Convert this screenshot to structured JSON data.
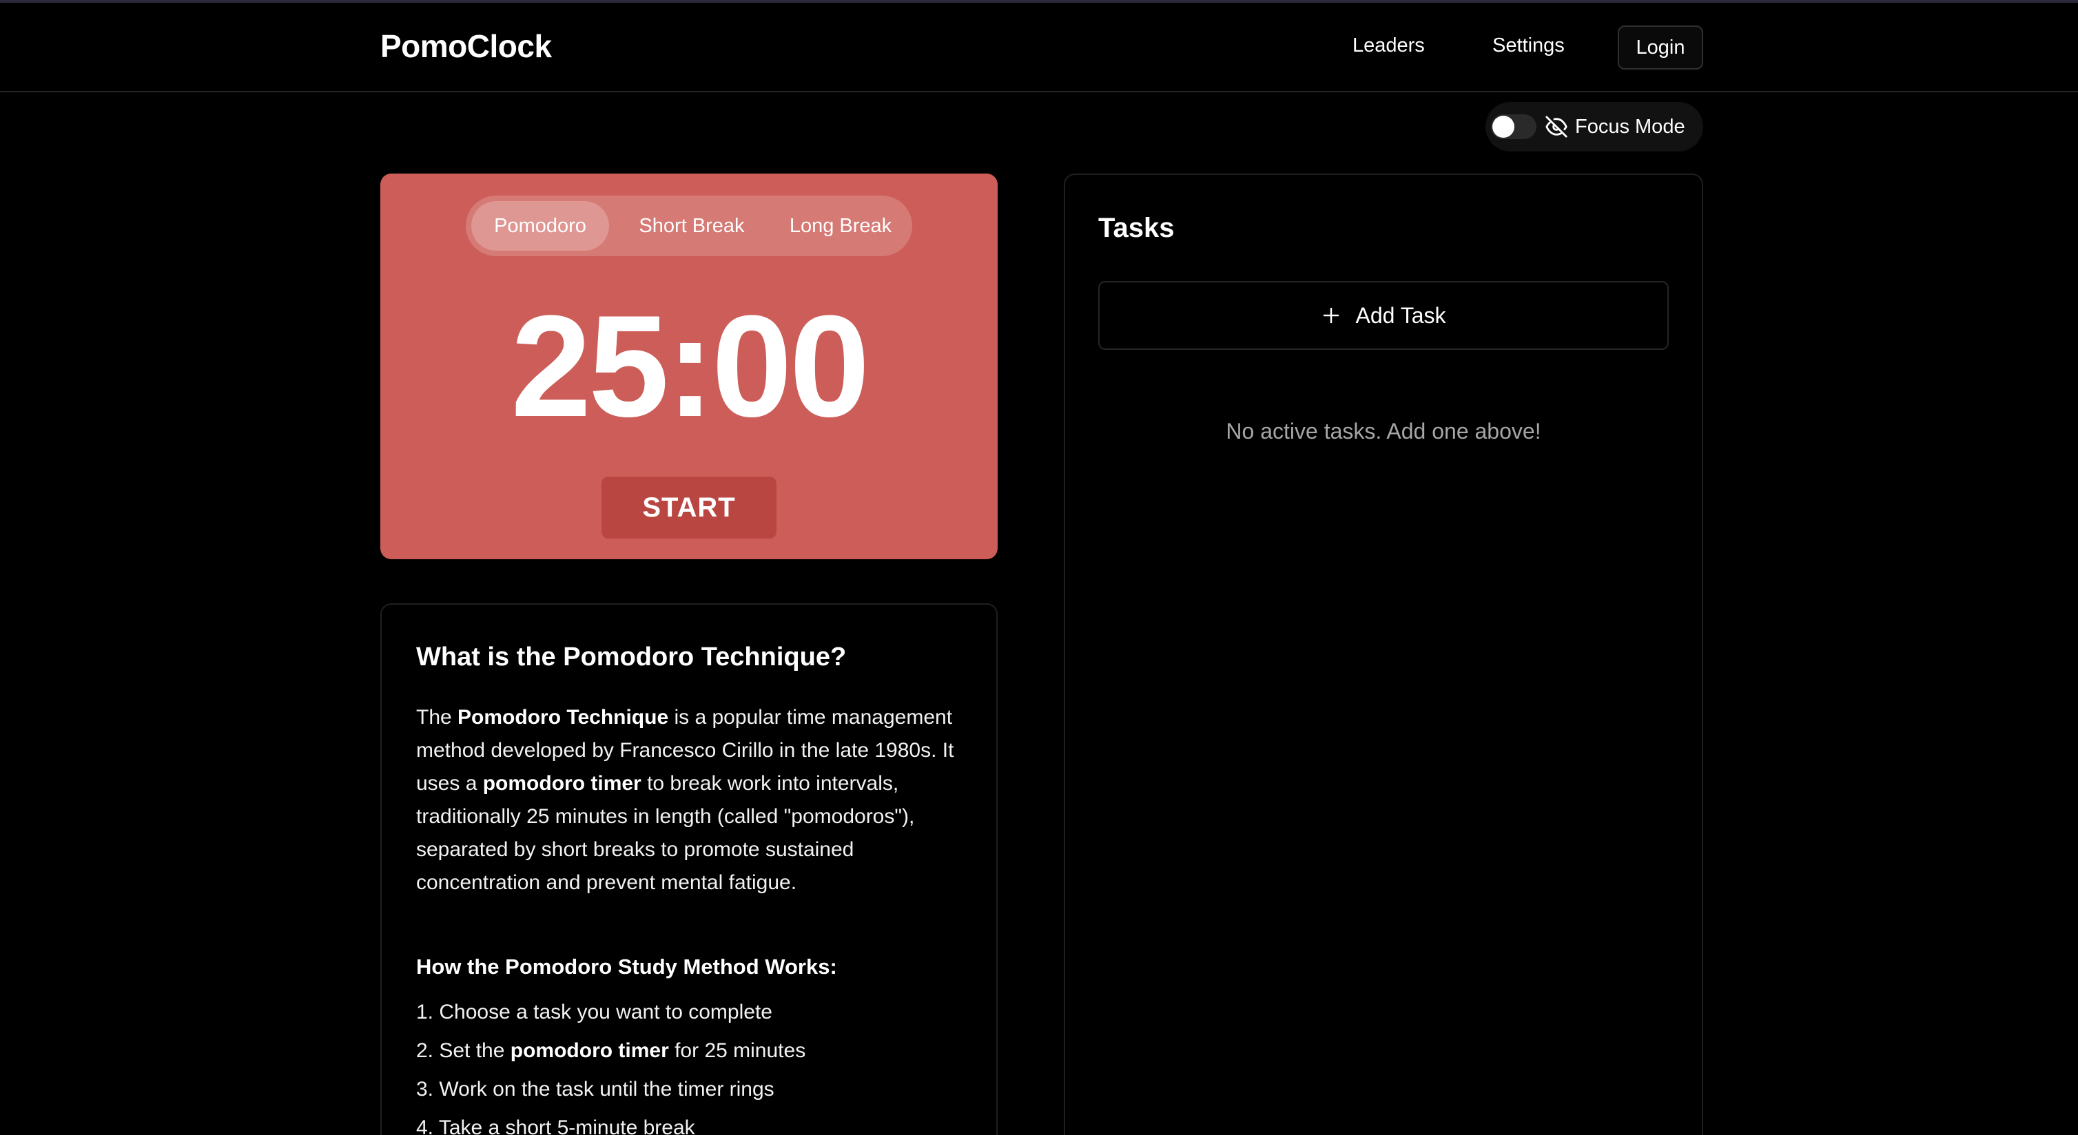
{
  "app": {
    "logo": "PomoClock"
  },
  "nav": {
    "leaders": "Leaders",
    "settings": "Settings",
    "login": "Login"
  },
  "focus_mode": {
    "label": "Focus Mode",
    "enabled": false,
    "icon": "eye-off-icon"
  },
  "timer": {
    "tabs": [
      "Pomodoro",
      "Short Break",
      "Long Break"
    ],
    "active_tab": "Pomodoro",
    "display": "25:00",
    "start_label": "START",
    "accent_color": "#cd5d58"
  },
  "info": {
    "title": "What is the Pomodoro Technique?",
    "para": {
      "t1": "The ",
      "b1": "Pomodoro Technique",
      "t2": " is a popular time management method developed by Francesco Cirillo in the late 1980s. It uses a ",
      "b2": "pomodoro timer",
      "t3": " to break work into intervals, traditionally 25 minutes in length (called \"pomodoros\"), separated by short breaks to promote sustained concentration and prevent mental fatigue."
    },
    "subtitle": "How the Pomodoro Study Method Works:",
    "steps": {
      "s1": "1. Choose a task you want to complete",
      "s2_pre": "2. Set the ",
      "s2_bold": "pomodoro timer",
      "s2_post": " for 25 minutes",
      "s3": "3. Work on the task until the timer rings",
      "s4": "4. Take a short 5-minute break"
    }
  },
  "tasks": {
    "title": "Tasks",
    "add_label": "Add Task",
    "empty_message": "No active tasks. Add one above!"
  }
}
